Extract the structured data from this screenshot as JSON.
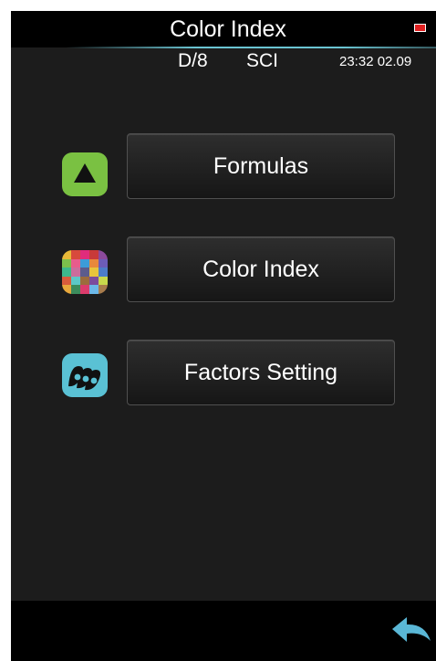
{
  "header": {
    "title": "Color Index",
    "battery_icon": "battery-low-icon",
    "battery_color": "#e02020",
    "accent_line_color": "#6ac4d2"
  },
  "status": {
    "geometry": "D/8",
    "mode": "SCI",
    "datetime": "23:32  02.09"
  },
  "menu": {
    "items": [
      {
        "label": "Formulas",
        "icon": "triangle-icon",
        "icon_color": "#7ac142"
      },
      {
        "label": "Color Index",
        "icon": "color-grid-icon"
      },
      {
        "label": "Factors Setting",
        "icon": "factors-icon",
        "icon_color": "#5ac1d4"
      }
    ]
  },
  "footer": {
    "back_icon": "back-arrow-icon",
    "back_color": "#5ab7d6"
  }
}
